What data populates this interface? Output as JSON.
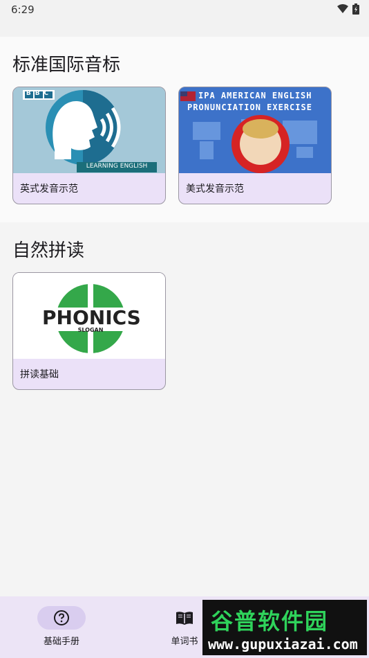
{
  "status": {
    "time": "6:29",
    "wifi_icon": "wifi-icon",
    "battery_icon": "battery-icon"
  },
  "sections": [
    {
      "title": "标准国际音标",
      "cards": [
        {
          "label": "英式发音示范",
          "thumb_badge": "BBC",
          "thumb_caption": "LEARNING ENGLISH"
        },
        {
          "label": "美式发音示范",
          "thumb_line1": "IPA AMERICAN ENGLISH",
          "thumb_line2": "PRONUNCIATION EXERCISE"
        }
      ]
    },
    {
      "title": "自然拼读",
      "cards": [
        {
          "label": "拼读基础",
          "thumb_title": "PHONICS",
          "thumb_sub": "SLOGAN"
        }
      ]
    }
  ],
  "nav": {
    "items": [
      {
        "label": "基础手册",
        "icon": "help-circle-icon",
        "active": true
      },
      {
        "label": "单词书",
        "icon": "book-open-icon",
        "active": false
      }
    ]
  },
  "watermark": {
    "big": "谷普软件园",
    "small": "www.gupuxiazai.com"
  },
  "colors": {
    "card_bg": "#ebe1f8",
    "nav_bg": "#ece4f6",
    "nav_active": "#d9cdef"
  }
}
